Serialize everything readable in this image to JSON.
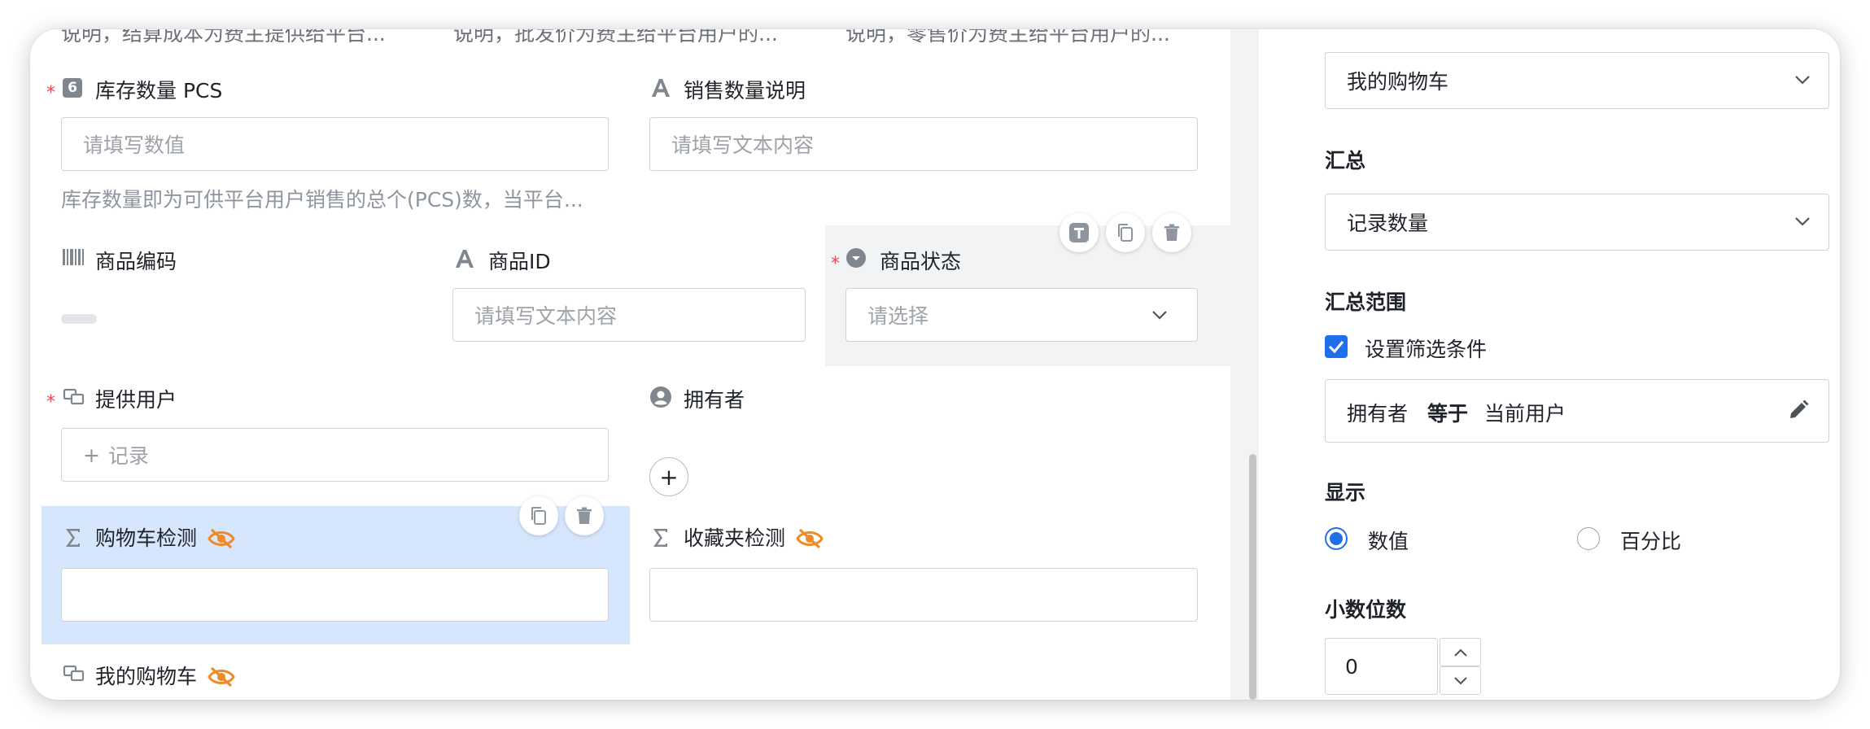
{
  "top_row": {
    "col1": "说明，结算成本为费主提供给平台...",
    "col2": "说明，批发价为费主给平台用户的...",
    "col3": "说明，零售价为费主给平台用户的..."
  },
  "form": {
    "required_mark": "*",
    "stock": {
      "icon_text": "6",
      "label": "库存数量 PCS",
      "placeholder": "请填写数值",
      "hint": "库存数量即为可供平台用户销售的总个(PCS)数，当平台..."
    },
    "sales_desc": {
      "label": "销售数量说明",
      "placeholder": "请填写文本内容"
    },
    "product_code": {
      "label": "商品编码"
    },
    "product_id": {
      "label": "商品ID",
      "placeholder": "请填写文本内容"
    },
    "product_status": {
      "label": "商品状态",
      "placeholder": "请选择"
    },
    "provider": {
      "label": "提供用户",
      "placeholder": "记录",
      "plus": "+"
    },
    "owner": {
      "label": "拥有者",
      "plus": "+"
    },
    "cart_check": {
      "label": "购物车检测"
    },
    "favorite_check": {
      "label": "收藏夹检测"
    },
    "my_cart": {
      "label": "我的购物车"
    }
  },
  "right_panel": {
    "link_table": {
      "value": "我的购物车"
    },
    "summary": {
      "title": "汇总",
      "value": "记录数量"
    },
    "summary_range": {
      "title": "汇总范围",
      "checkbox_label": "设置筛选条件",
      "checked": true,
      "filter": {
        "field": "拥有者",
        "operator": "等于",
        "value": "当前用户"
      }
    },
    "display": {
      "title": "显示",
      "options": [
        {
          "label": "数值",
          "selected": true
        },
        {
          "label": "百分比",
          "selected": false
        }
      ]
    },
    "decimals": {
      "title": "小数位数",
      "value": "0"
    }
  },
  "colors": {
    "accent": "#1f6feb",
    "required": "#e34d59",
    "hidden_eye": "#f08a24",
    "highlight_blue": "#d6e6fc",
    "highlight_grey": "#f2f3f4"
  },
  "icons": [
    "number-icon",
    "text-icon",
    "barcode-icon",
    "dropdown-icon",
    "link-record-icon",
    "user-icon",
    "sigma-icon",
    "eye-off-icon",
    "text-format-icon",
    "copy-icon",
    "trash-icon",
    "chevron-down-icon",
    "chevron-up-icon",
    "pencil-icon",
    "check-icon",
    "plus-icon"
  ]
}
